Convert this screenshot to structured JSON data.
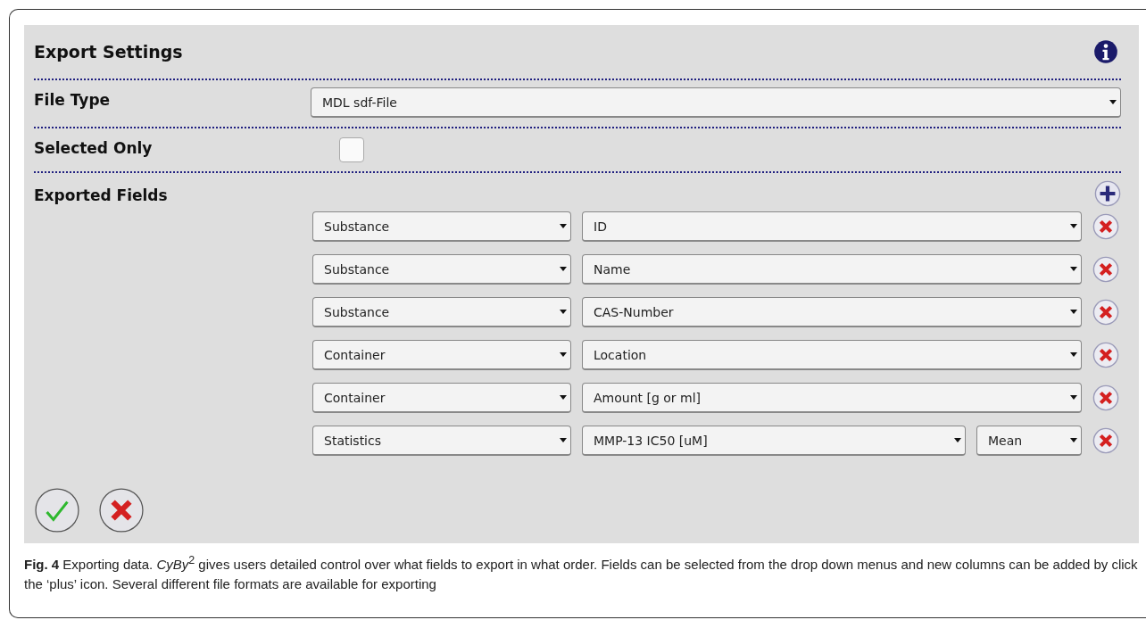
{
  "title": "Export Settings",
  "file_type": {
    "label": "File Type",
    "value": "MDL sdf-File"
  },
  "selected_only": {
    "label": "Selected Only",
    "checked": false
  },
  "exported_fields": {
    "label": "Exported Fields",
    "rows": [
      {
        "source": "Substance",
        "field": "ID"
      },
      {
        "source": "Substance",
        "field": "Name"
      },
      {
        "source": "Substance",
        "field": "CAS-Number"
      },
      {
        "source": "Container",
        "field": "Location"
      },
      {
        "source": "Container",
        "field": "Amount [g or ml]"
      },
      {
        "source": "Statistics",
        "field": "MMP-13 IC50 [uM]",
        "aggregate": "Mean"
      }
    ]
  },
  "caption": "**Fig. 4**  Exporting data. *CyBy*$^{2}$ gives users detailed control over what fields to export in what order. Fields can be selected from the drop down menus and new columns can be added by click the ‘plus’ icon. Several different file formats are available for exporting"
}
